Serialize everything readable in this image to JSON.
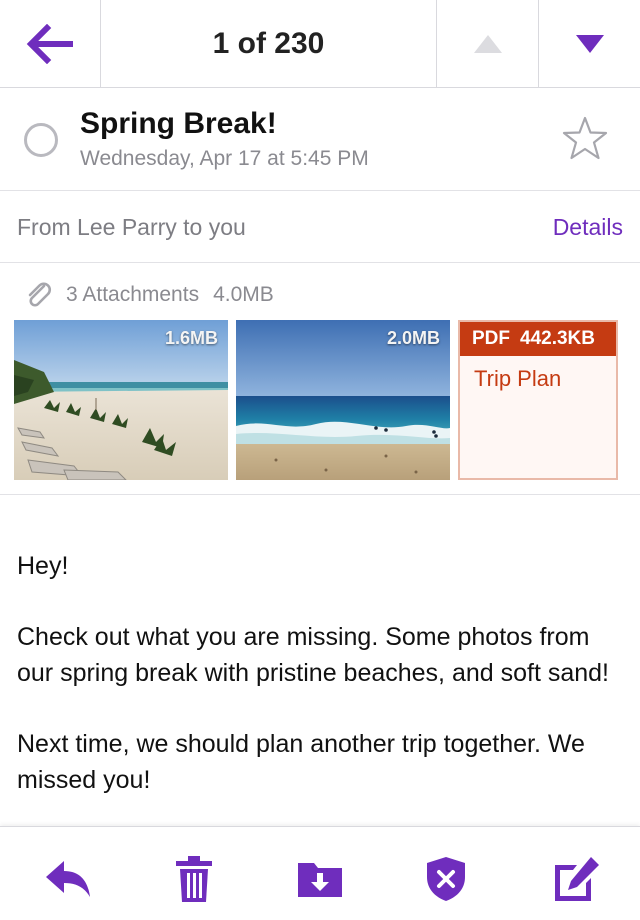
{
  "nav": {
    "counter": "1 of 230"
  },
  "message": {
    "subject": "Spring Break!",
    "date": "Wednesday, Apr 17 at 5:45 PM",
    "from_line": "From Lee Parry to you",
    "details_label": "Details"
  },
  "attachments": {
    "count_label": "3 Attachments",
    "total_size": "4.0MB",
    "items": [
      {
        "kind": "image",
        "size": "1.6MB",
        "subject": "beach with lounge chairs and palm seedlings"
      },
      {
        "kind": "image",
        "size": "2.0MB",
        "subject": "ocean waves on sandy shore"
      },
      {
        "kind": "pdf",
        "type_label": "PDF",
        "size": "442.3KB",
        "name": "Trip Plan"
      }
    ]
  },
  "body": {
    "paragraphs": [
      "Hey!",
      "Check out what you are missing. Some photos from our spring break with pristine beaches, and soft sand!",
      "Next time, we should plan another trip together. We missed you!"
    ]
  },
  "toolbar": {
    "icons": [
      "reply-icon",
      "trash-icon",
      "move-to-folder-icon",
      "spam-shield-icon",
      "compose-icon"
    ]
  },
  "colors": {
    "accent": "#6f2dbd",
    "pdf_red": "#c53b12",
    "muted_text": "#8a8a90",
    "divider": "#e2e2e6"
  }
}
